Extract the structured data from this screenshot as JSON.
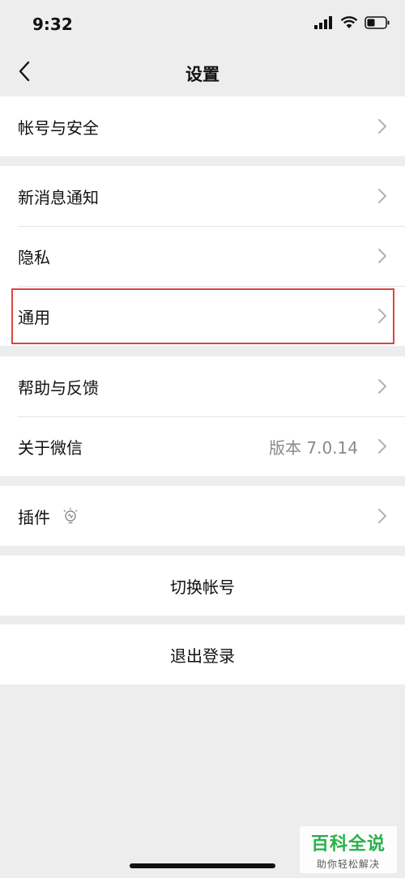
{
  "status_bar": {
    "time": "9:32",
    "icons": [
      "signal-icon",
      "wifi-icon",
      "battery-icon"
    ]
  },
  "nav": {
    "title": "设置",
    "back_icon": "chevron-left-icon"
  },
  "groups": [
    {
      "items": [
        {
          "label": "帐号与安全"
        }
      ]
    },
    {
      "items": [
        {
          "label": "新消息通知"
        },
        {
          "label": "隐私"
        },
        {
          "label": "通用",
          "highlighted": true
        }
      ]
    },
    {
      "items": [
        {
          "label": "帮助与反馈"
        },
        {
          "label": "关于微信",
          "value": "版本 7.0.14"
        }
      ]
    },
    {
      "items": [
        {
          "label": "插件",
          "icon": "lightbulb-icon"
        }
      ]
    }
  ],
  "actions": {
    "switch_account": "切换帐号",
    "logout": "退出登录"
  },
  "watermark": {
    "title": "百科全说",
    "subtitle": "助你轻松解决"
  },
  "colors": {
    "background": "#ededed",
    "card": "#ffffff",
    "highlight_border": "#d9463f",
    "watermark_green": "#29b14a"
  }
}
